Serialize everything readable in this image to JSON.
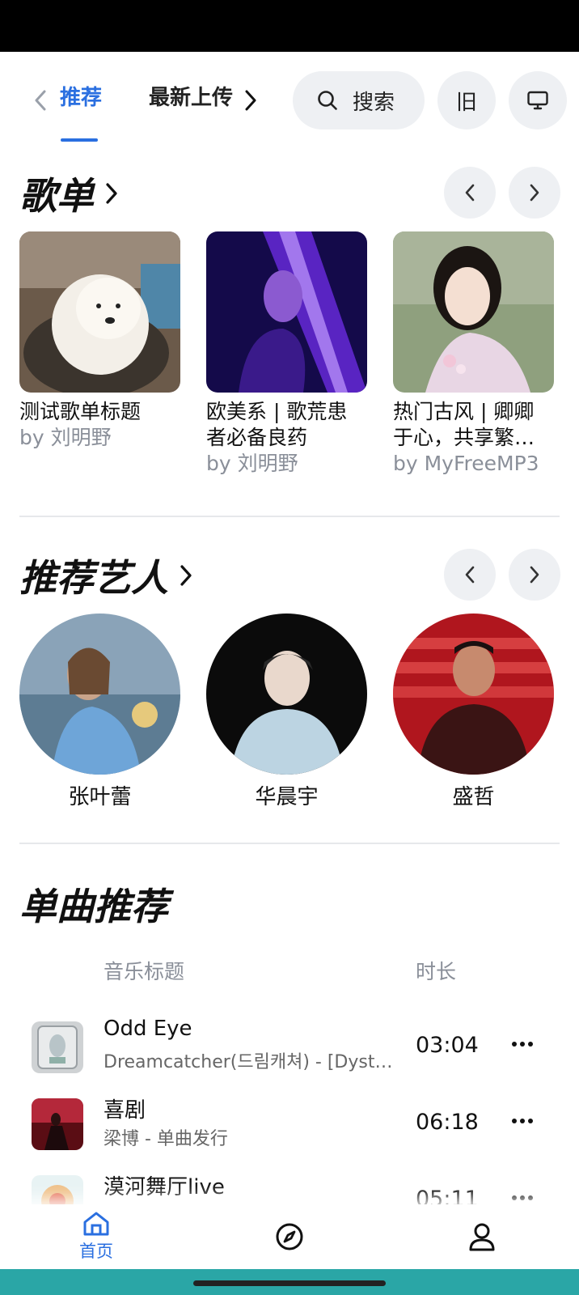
{
  "top_nav": {
    "tabs": [
      {
        "label": "推荐",
        "active": true
      },
      {
        "label": "最新上传",
        "active": false
      }
    ],
    "search_label": "搜索",
    "mode_button_label": "旧"
  },
  "playlists": {
    "title": "歌单",
    "items": [
      {
        "title": "测试歌单标题",
        "byline": "by 刘明野"
      },
      {
        "title": "欧美系 | 歌荒患者必备良药",
        "byline": "by 刘明野"
      },
      {
        "title": "热门古风 | 卿卿于心，共享繁…",
        "byline": "by MyFreeMP3"
      }
    ]
  },
  "artists": {
    "title": "推荐艺人",
    "items": [
      {
        "name": "张叶蕾"
      },
      {
        "name": "华晨宇"
      },
      {
        "name": "盛哲"
      }
    ]
  },
  "songs": {
    "title": "单曲推荐",
    "col_title": "音乐标题",
    "col_duration": "时长",
    "items": [
      {
        "title": "Odd Eye",
        "subtitle": "Dreamcatcher(드림캐쳐) - [Dystopia : Road to Utopia]",
        "duration": "03:04"
      },
      {
        "title": "喜剧",
        "subtitle": "梁博 - 单曲发行",
        "duration": "06:18"
      },
      {
        "title": "漠河舞厅live",
        "subtitle": "",
        "duration": "05:11"
      }
    ]
  },
  "bottom_nav": {
    "home_label": "首页"
  },
  "colors": {
    "accent": "#2a6fe0",
    "pill_bg": "#eef0f3",
    "muted_text": "#8a8f99",
    "system_bar": "#2aa6a6"
  }
}
